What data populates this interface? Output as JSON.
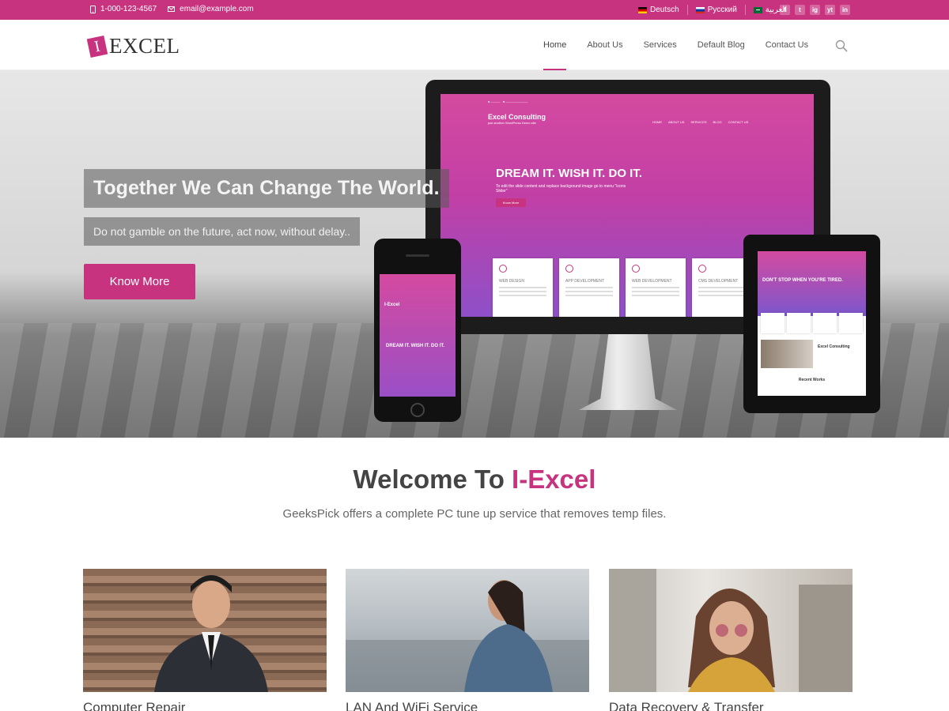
{
  "topbar": {
    "phone": "1-000-123-4567",
    "email": "email@example.com",
    "languages": [
      "Deutsch",
      "Русский",
      "العربية"
    ],
    "social": [
      "f",
      "t",
      "ig",
      "yt",
      "in"
    ]
  },
  "header": {
    "logo_mark": "I",
    "logo_text": "EXCEL",
    "nav": [
      "Home",
      "About Us",
      "Services",
      "Default Blog",
      "Contact Us"
    ],
    "active_nav": "Home"
  },
  "hero": {
    "title": "Together We Can Change The World.",
    "subtitle": "Do not gamble on the future, act now, without delay..",
    "button": "Know More",
    "monitor": {
      "brand": "Excel Consulting",
      "tagline": "just another WordPress Demo site",
      "nav": [
        "HOME",
        "ABOUT US",
        "SERVICES",
        "BLOG",
        "CONTACT US"
      ],
      "headline": "DREAM IT. WISH IT. DO IT.",
      "text": "To edit the slide content and replace background image go to menu \"Icons Slider\"",
      "button": "Know More",
      "cards": [
        "WEB DESIGN",
        "APP DEVELOPMENT",
        "WEB DEVELOPMENT",
        "CMS DEVELOPMENT"
      ]
    },
    "phone": {
      "brand": "I-Excel",
      "headline": "DREAM IT. WISH IT. DO IT."
    },
    "tablet": {
      "headline": "DON'T STOP WHEN YOU'RE TIRED.",
      "section": "Excel Consulting",
      "recent": "Recent Works"
    }
  },
  "welcome": {
    "title_plain": "Welcome To ",
    "title_accent": "I-Excel",
    "subtitle": "GeeksPick offers a complete PC tune up service that removes temp files."
  },
  "services": [
    {
      "label": "Computer Repair"
    },
    {
      "label": "LAN And WiFi Service"
    },
    {
      "label": "Data Recovery & Transfer"
    }
  ],
  "colors": {
    "accent": "#c8337f",
    "text": "#444444"
  }
}
